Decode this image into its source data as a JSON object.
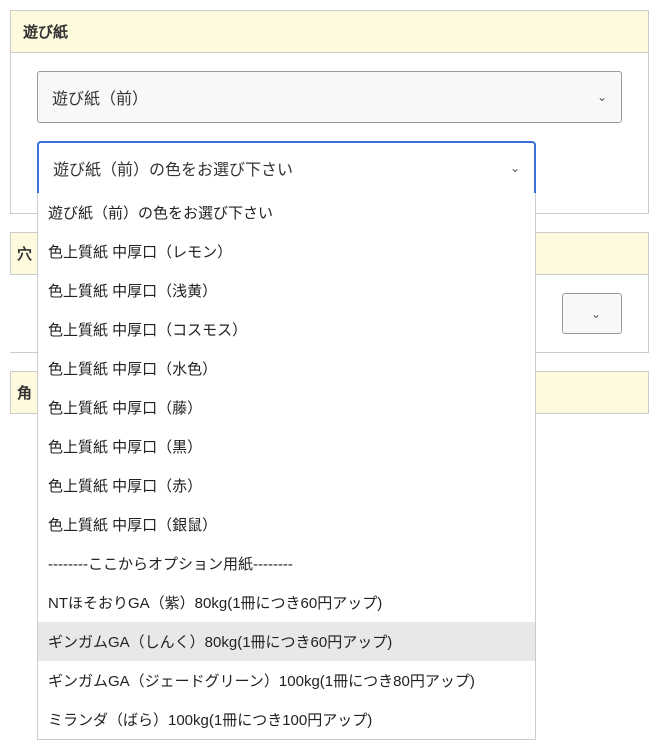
{
  "section1": {
    "title": "遊び紙",
    "select1": {
      "value": "遊び紙（前）"
    },
    "select2": {
      "value": "遊び紙（前）の色をお選び下さい",
      "options": [
        "遊び紙（前）の色をお選び下さい",
        "色上質紙 中厚口（レモン）",
        "色上質紙 中厚口（浅黄）",
        "色上質紙 中厚口（コスモス）",
        "色上質紙 中厚口（水色）",
        "色上質紙 中厚口（藤）",
        "色上質紙 中厚口（黒）",
        "色上質紙 中厚口（赤）",
        "色上質紙 中厚口（銀鼠）",
        "--------ここからオプション用紙--------",
        "NTほそおりGA（紫）80kg(1冊につき60円アップ)",
        "ギンガムGA（しんく）80kg(1冊につき60円アップ)",
        "ギンガムGA（ジェードグリーン）100kg(1冊につき80円アップ)",
        "ミランダ（ばら）100kg(1冊につき100円アップ)"
      ],
      "highlighted_index": 11
    }
  },
  "section2": {
    "title_partial": "穴"
  },
  "section3": {
    "title_partial": "角"
  }
}
